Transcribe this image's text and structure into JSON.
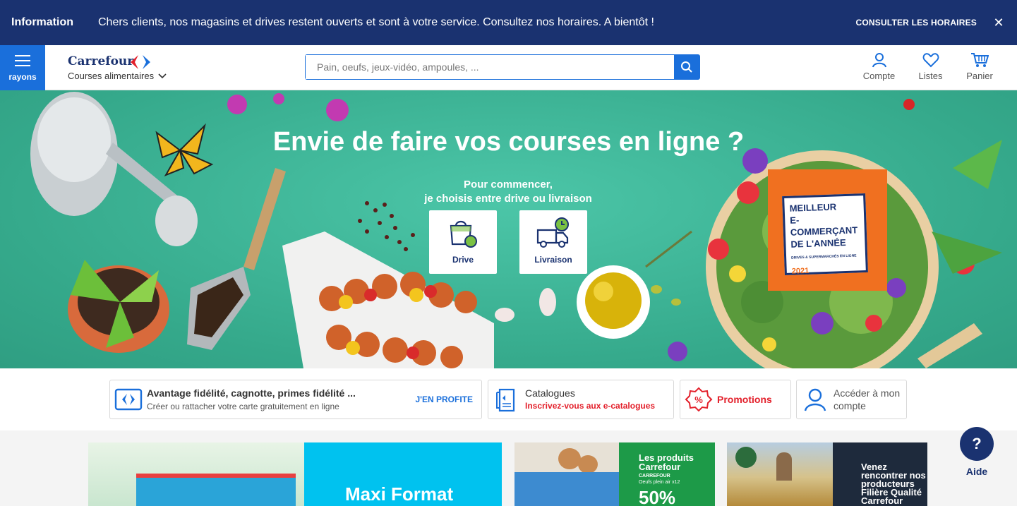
{
  "infobar": {
    "label": "Information",
    "message": "Chers clients, nos magasins et drives restent ouverts et sont à votre service. Consultez nos horaires. A bientôt !",
    "cta": "CONSULTER LES HORAIRES",
    "close_icon": "close-icon"
  },
  "header": {
    "rayons_label": "rayons",
    "brand_name": "Carrefour",
    "brand_sub": "Courses alimentaires",
    "search_placeholder": "Pain, oeufs, jeux-vidéo, ampoules, ...",
    "account_label": "Compte",
    "lists_label": "Listes",
    "cart_label": "Panier"
  },
  "hero": {
    "title": "Envie de faire vos courses en ligne ?",
    "subtitle_line1": "Pour commencer,",
    "subtitle_line2": "je choisis entre drive ou livraison",
    "drive_label": "Drive",
    "delivery_label": "Livraison",
    "badge": {
      "line1": "MEILLEUR",
      "line2": "E-COMMERÇANT",
      "line3": "DE L'ANNÉE",
      "small": "DRIVES & SUPERMARCHÉS EN LIGNE",
      "year": "2021"
    }
  },
  "services": {
    "loyalty_title": "Avantage fidélité, cagnotte, primes fidélité ...",
    "loyalty_sub": "Créer ou rattacher votre carte gratuitement en ligne",
    "loyalty_cta": "J'EN PROFITE",
    "catalog_title": "Catalogues",
    "catalog_sub": "Inscrivez-vous aux e-catalogues",
    "promo_label": "Promotions",
    "account_line1": "Accéder à mon",
    "account_line2": "compte"
  },
  "tiles": {
    "tile1_text": "Maxi Format",
    "tile2_title1": "Les produits",
    "tile2_title2": "Carrefour",
    "tile2_pack1": "CARREFOUR",
    "tile2_pack2": "Oeufs plein air x12",
    "tile2_value": "50%",
    "tile3_line1": "Venez",
    "tile3_line2": "rencontrer nos",
    "tile3_line3": "producteurs",
    "tile3_line4": "Filière Qualité",
    "tile3_line5": "Carrefour"
  },
  "help": {
    "label": "Aide",
    "symbol": "?"
  },
  "colors": {
    "navy": "#1a3270",
    "blue": "#1a6fdb",
    "red": "#e3202b",
    "green": "#3fb89a",
    "orange": "#f07020"
  }
}
